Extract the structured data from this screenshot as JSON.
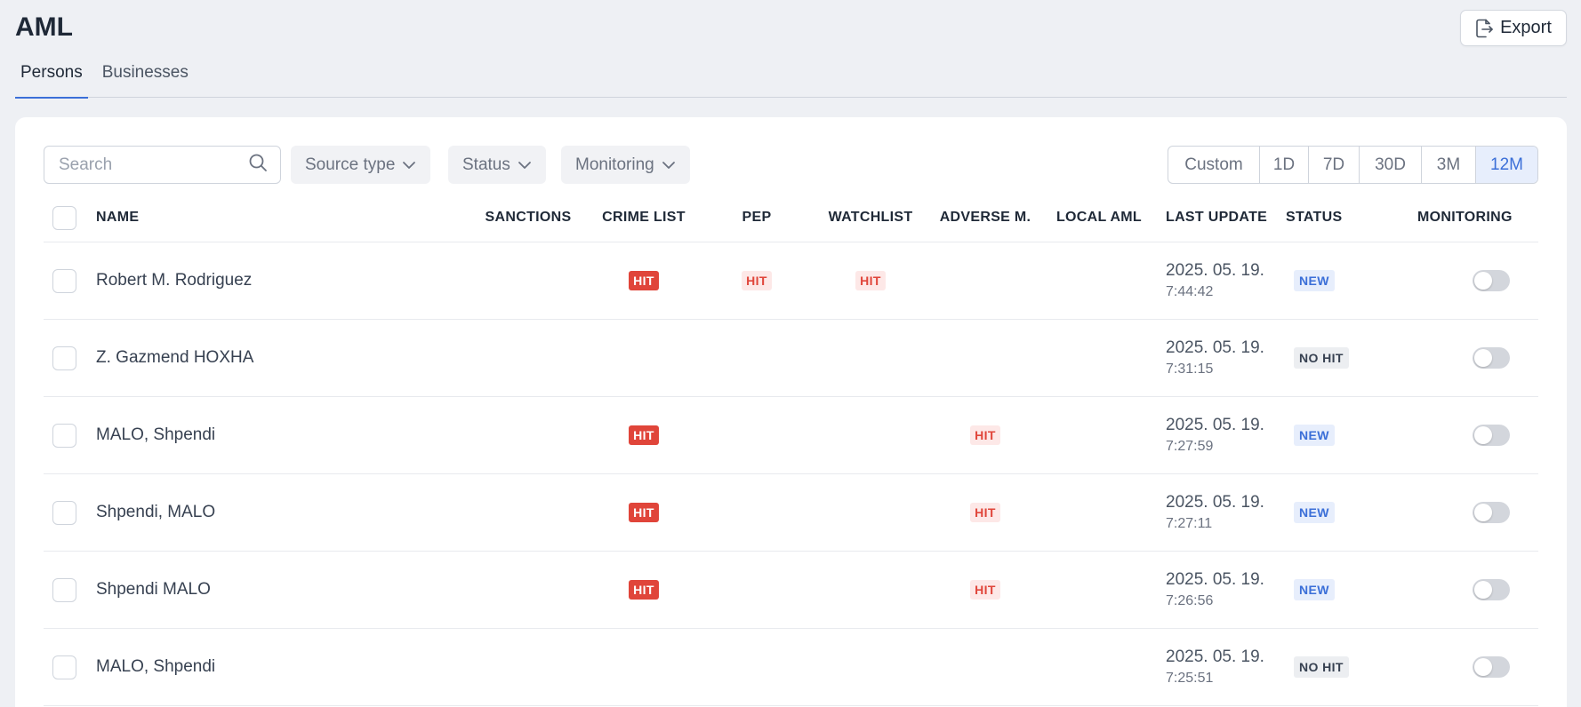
{
  "header": {
    "title": "AML",
    "export_label": "Export"
  },
  "tabs": [
    {
      "label": "Persons",
      "active": true
    },
    {
      "label": "Businesses",
      "active": false
    }
  ],
  "toolbar": {
    "search_placeholder": "Search",
    "filters": [
      {
        "label": "Source type"
      },
      {
        "label": "Status"
      },
      {
        "label": "Monitoring"
      }
    ],
    "ranges": [
      {
        "label": "Custom",
        "active": false
      },
      {
        "label": "1D",
        "active": false
      },
      {
        "label": "7D",
        "active": false
      },
      {
        "label": "30D",
        "active": false
      },
      {
        "label": "3M",
        "active": false
      },
      {
        "label": "12M",
        "active": true
      }
    ]
  },
  "table": {
    "columns": {
      "name": "NAME",
      "sanctions": "SANCTIONS",
      "crime_list": "CRIME LIST",
      "pep": "PEP",
      "watchlist": "WATCHLIST",
      "adverse": "ADVERSE M.",
      "local_aml": "LOCAL AML",
      "last_update": "LAST UPDATE",
      "status": "STATUS",
      "monitoring": "MONITORING"
    },
    "rows": [
      {
        "name": "Robert M. Rodriguez",
        "sanctions": "",
        "crime_list": "HIT",
        "pep": "HIT",
        "watchlist": "HIT",
        "adverse": "",
        "local_aml": "",
        "date": "2025. 05. 19.",
        "time": "7:44:42",
        "status": "NEW",
        "monitoring": false
      },
      {
        "name": "Z. Gazmend HOXHA",
        "sanctions": "",
        "crime_list": "",
        "pep": "",
        "watchlist": "",
        "adverse": "",
        "local_aml": "",
        "date": "2025. 05. 19.",
        "time": "7:31:15",
        "status": "NO HIT",
        "monitoring": false
      },
      {
        "name": "MALO, Shpendi",
        "sanctions": "",
        "crime_list": "HIT",
        "pep": "",
        "watchlist": "",
        "adverse": "HIT",
        "local_aml": "",
        "date": "2025. 05. 19.",
        "time": "7:27:59",
        "status": "NEW",
        "monitoring": false
      },
      {
        "name": "Shpendi, MALO",
        "sanctions": "",
        "crime_list": "HIT",
        "pep": "",
        "watchlist": "",
        "adverse": "HIT",
        "local_aml": "",
        "date": "2025. 05. 19.",
        "time": "7:27:11",
        "status": "NEW",
        "monitoring": false
      },
      {
        "name": "Shpendi MALO",
        "sanctions": "",
        "crime_list": "HIT",
        "pep": "",
        "watchlist": "",
        "adverse": "HIT",
        "local_aml": "",
        "date": "2025. 05. 19.",
        "time": "7:26:56",
        "status": "NEW",
        "monitoring": false
      },
      {
        "name": "MALO, Shpendi",
        "sanctions": "",
        "crime_list": "",
        "pep": "",
        "watchlist": "",
        "adverse": "",
        "local_aml": "",
        "date": "2025. 05. 19.",
        "time": "7:25:51",
        "status": "NO HIT",
        "monitoring": false
      }
    ]
  },
  "colors": {
    "accent": "#3b6fd8",
    "hit_solid_bg": "#e0453a",
    "hit_light_bg": "#fde8e7",
    "new_bg": "#e7eefc",
    "nohit_bg": "#eceef1"
  },
  "icons": {
    "export": "export-icon",
    "search": "search-icon",
    "chevron": "chevron-down-icon"
  }
}
